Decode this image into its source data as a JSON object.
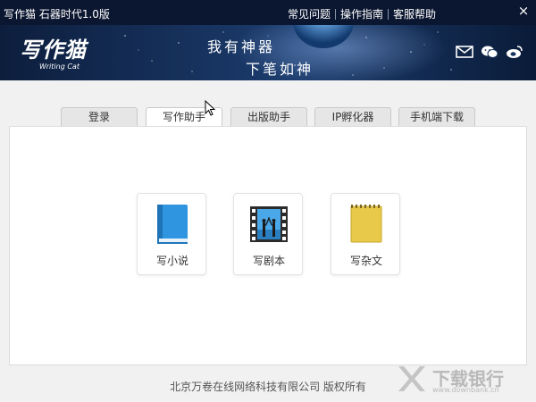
{
  "titlebar": {
    "app_title": "写作猫  石器时代1.0版",
    "links": [
      "常见问题",
      "操作指南",
      "客服帮助"
    ],
    "close_label": "×"
  },
  "banner": {
    "logo_text": "写作猫",
    "logo_sub": "Writing Cat",
    "slogan_line1": "我有神器",
    "slogan_line2": "下笔如神",
    "social_icons": [
      "mail-icon",
      "wechat-icon",
      "weibo-icon"
    ]
  },
  "tabs": [
    {
      "label": "登录",
      "active": false
    },
    {
      "label": "写作助手",
      "active": true
    },
    {
      "label": "出版助手",
      "active": false
    },
    {
      "label": "IP孵化器",
      "active": false
    },
    {
      "label": "手机端下载",
      "active": false
    }
  ],
  "cards": [
    {
      "label": "写小说",
      "icon": "blue-book-icon"
    },
    {
      "label": "写剧本",
      "icon": "film-strip-icon"
    },
    {
      "label": "写杂文",
      "icon": "yellow-notebook-icon"
    }
  ],
  "footer": {
    "copyright": "北京万卷在线网络科技有限公司  版权所有"
  },
  "watermark": {
    "text": "下载银行",
    "sub": "www.downbank.cn"
  },
  "colors": {
    "titlebar_bg": "#0b1630",
    "banner_bg": "#16315c",
    "panel_bg": "#ffffff",
    "window_bg": "#f1f1f1"
  }
}
